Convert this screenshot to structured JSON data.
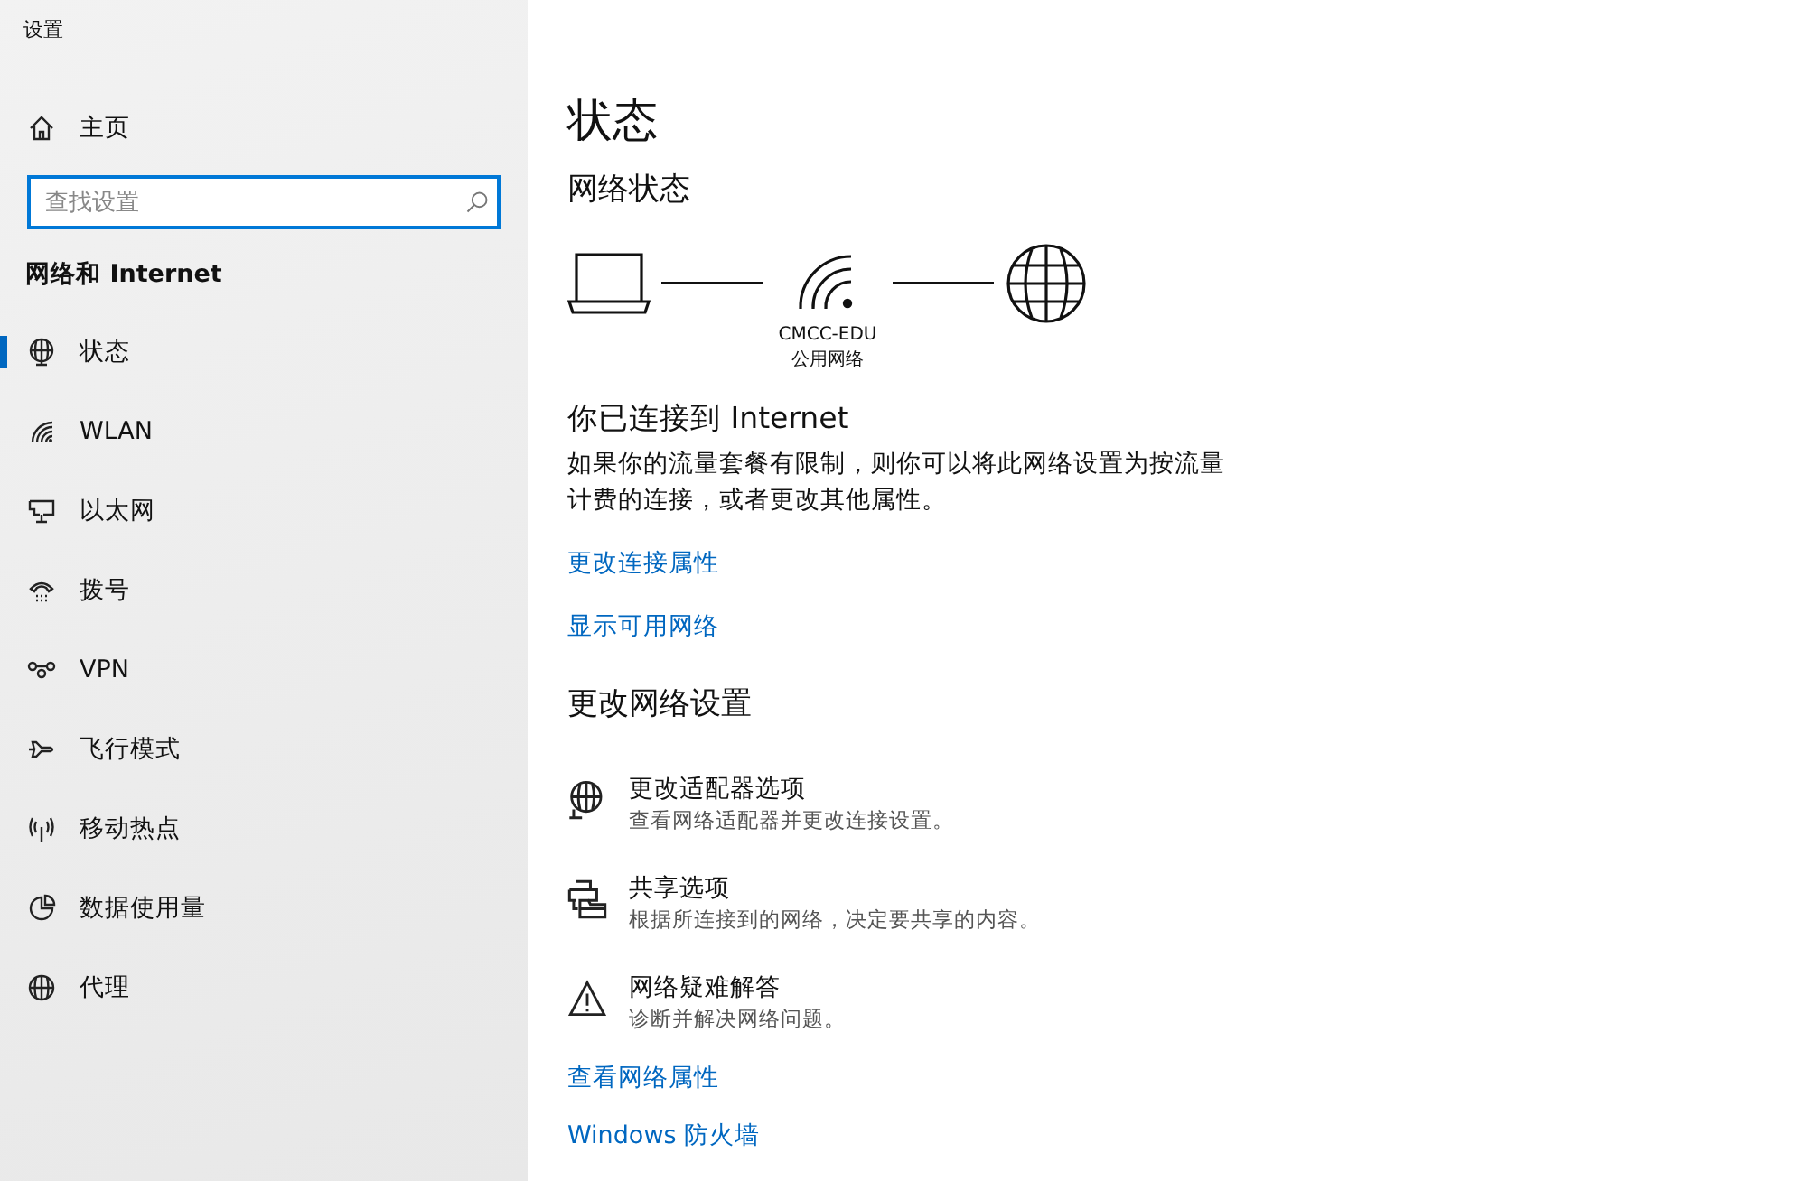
{
  "window": {
    "title": "设置"
  },
  "sidebar": {
    "home": {
      "label": "主页"
    },
    "search": {
      "placeholder": "查找设置"
    },
    "section_title": "网络和 Internet",
    "items": [
      {
        "label": "状态",
        "kind": "status",
        "selected": true
      },
      {
        "label": "WLAN",
        "kind": "wlan",
        "selected": false
      },
      {
        "label": "以太网",
        "kind": "ethernet",
        "selected": false
      },
      {
        "label": "拨号",
        "kind": "dialup",
        "selected": false
      },
      {
        "label": "VPN",
        "kind": "vpn",
        "selected": false
      },
      {
        "label": "飞行模式",
        "kind": "airplane",
        "selected": false
      },
      {
        "label": "移动热点",
        "kind": "hotspot",
        "selected": false
      },
      {
        "label": "数据使用量",
        "kind": "datausage",
        "selected": false
      },
      {
        "label": "代理",
        "kind": "proxy",
        "selected": false
      }
    ]
  },
  "main": {
    "title": "状态",
    "network_status": {
      "heading": "网络状态",
      "network_name": "CMCC-EDU",
      "network_type": "公用网络"
    },
    "connected_title": "你已连接到 Internet",
    "description": "如果你的流量套餐有限制，则你可以将此网络设置为按流量计费的连接，或者更改其他属性。",
    "links": [
      "更改连接属性",
      "显示可用网络"
    ],
    "change_heading": "更改网络设置",
    "options": [
      {
        "kind": "adapter",
        "title": "更改适配器选项",
        "subtitle": "查看网络适配器并更改连接设置。"
      },
      {
        "kind": "sharing",
        "title": "共享选项",
        "subtitle": "根据所连接到的网络，决定要共享的内容。"
      },
      {
        "kind": "troubleshoot",
        "title": "网络疑难解答",
        "subtitle": "诊断并解决网络问题。"
      }
    ],
    "bottom_links": [
      "查看网络属性",
      "Windows 防火墙"
    ]
  }
}
